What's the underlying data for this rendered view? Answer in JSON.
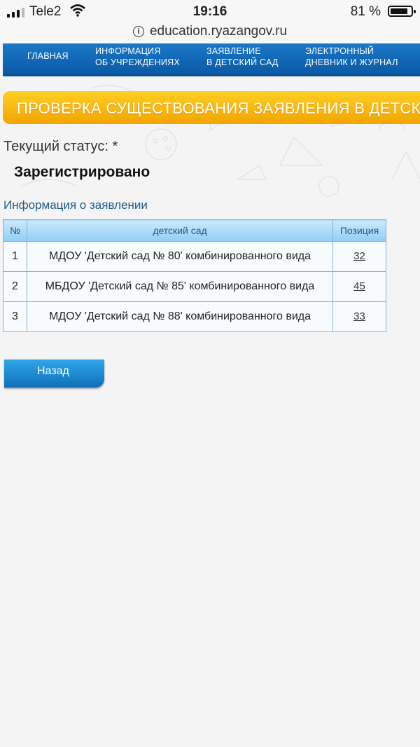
{
  "statusbar": {
    "carrier": "Tele2",
    "time": "19:16",
    "battery": "81 %",
    "battery_level": 0.81,
    "signal_bars_filled": 3
  },
  "browser": {
    "url": "education.ryazangov.ru"
  },
  "nav": {
    "home": "ГЛАВНАЯ",
    "info_line1": "ИНФОРМАЦИЯ",
    "info_line2": "ОБ УЧРЕЖДЕНИЯХ",
    "app_line1": "ЗАЯВЛЕНИЕ",
    "app_line2": "В ДЕТСКИЙ САД",
    "diary_line1": "ЭЛЕКТРОННЫЙ",
    "diary_line2": "ДНЕВНИК И ЖУРНАЛ"
  },
  "banner": {
    "title": "ПРОВЕРКА СУЩЕСТВОВАНИЯ ЗАЯВЛЕНИЯ В ДЕТСКИЙ САД"
  },
  "status": {
    "label": "Текущий статус: *",
    "value": "Зарегистрировано"
  },
  "info": {
    "heading": "Информация о заявлении"
  },
  "table": {
    "headers": {
      "num": "№",
      "kindergarten": "детский сад",
      "position": "Позиция"
    },
    "rows": [
      {
        "num": "1",
        "kindergarten": "МДОУ 'Детский сад № 80' комбинированного вида",
        "position": "32"
      },
      {
        "num": "2",
        "kindergarten": "МБДОУ 'Детский сад № 85' комбинированного вида",
        "position": "45"
      },
      {
        "num": "3",
        "kindergarten": "МДОУ 'Детский сад № 88' комбинированного вида",
        "position": "33"
      }
    ]
  },
  "actions": {
    "back": "Назад"
  },
  "colors": {
    "nav": "#0a5aa6",
    "banner": "#f3a400",
    "heading": "#1f5b8a",
    "button": "#0f6fb7"
  }
}
